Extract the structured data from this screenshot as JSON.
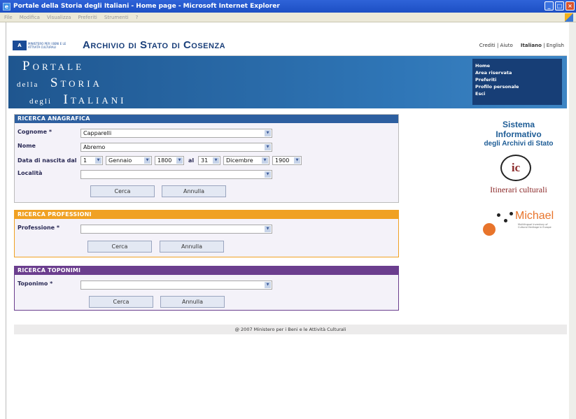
{
  "window": {
    "title": "Portale della Storia degli Italiani - Home page - Microsoft Internet Explorer",
    "menu": [
      "File",
      "Modifica",
      "Visualizza",
      "Preferiti",
      "Strumenti",
      "?"
    ]
  },
  "header": {
    "ministry_logo_text": "MINISTERO PER I BENI E LE ATTIVITÀ CULTURALI",
    "archive_title": "Archivio di Stato di Cosenza",
    "links": {
      "crediti": "Crediti",
      "sep1": "|",
      "aiuto": "Aiuto",
      "italiano": "Italiano",
      "sep2": "|",
      "english": "English"
    }
  },
  "banner": {
    "line1": "Portale",
    "line2a": "della",
    "line2b": "Storia",
    "line3a": "degli",
    "line3b": "Italiani"
  },
  "nav": [
    "Home",
    "Area riservata",
    "Preferiti",
    "Profilo personale",
    "Esci"
  ],
  "anagrafica": {
    "title": "RICERCA ANAGRAFICA",
    "cognome_label": "Cognome *",
    "cognome_value": "Capparelli",
    "nome_label": "Nome",
    "nome_value": "Abremo",
    "data_label": "Data di nascita dal",
    "al_label": "al",
    "day_from": "1",
    "month_from": "Gennaio",
    "year_from": "1800",
    "day_to": "31",
    "month_to": "Dicembre",
    "year_to": "1900",
    "localita_label": "Località",
    "localita_value": "",
    "cerca": "Cerca",
    "annulla": "Annulla"
  },
  "professioni": {
    "title": "RICERCA PROFESSIONI",
    "professione_label": "Professione *",
    "professione_value": "",
    "cerca": "Cerca",
    "annulla": "Annulla"
  },
  "toponimi": {
    "title": "RICERCA TOPONIMI",
    "toponimo_label": "Toponimo *",
    "toponimo_value": "",
    "cerca": "Cerca",
    "annulla": "Annulla"
  },
  "footer": "@ 2007 Ministero per i Beni e le Attività Culturali",
  "sidebar": {
    "sistema_line1": "Sistema Informativo",
    "sistema_line2": "degli Archivi di Stato",
    "ic_logo": "ic",
    "itinerari": "Itinerari culturali",
    "michael_name": "Michael",
    "michael_sub": "Multilingual Inventory of Cultural Heritage in Europe"
  },
  "colors": {
    "anagrafica": "#2d5fa0",
    "professioni": "#f0a123",
    "toponimi": "#6b3e8e",
    "banner": "#2a6aa8",
    "nav": "#173e76"
  }
}
